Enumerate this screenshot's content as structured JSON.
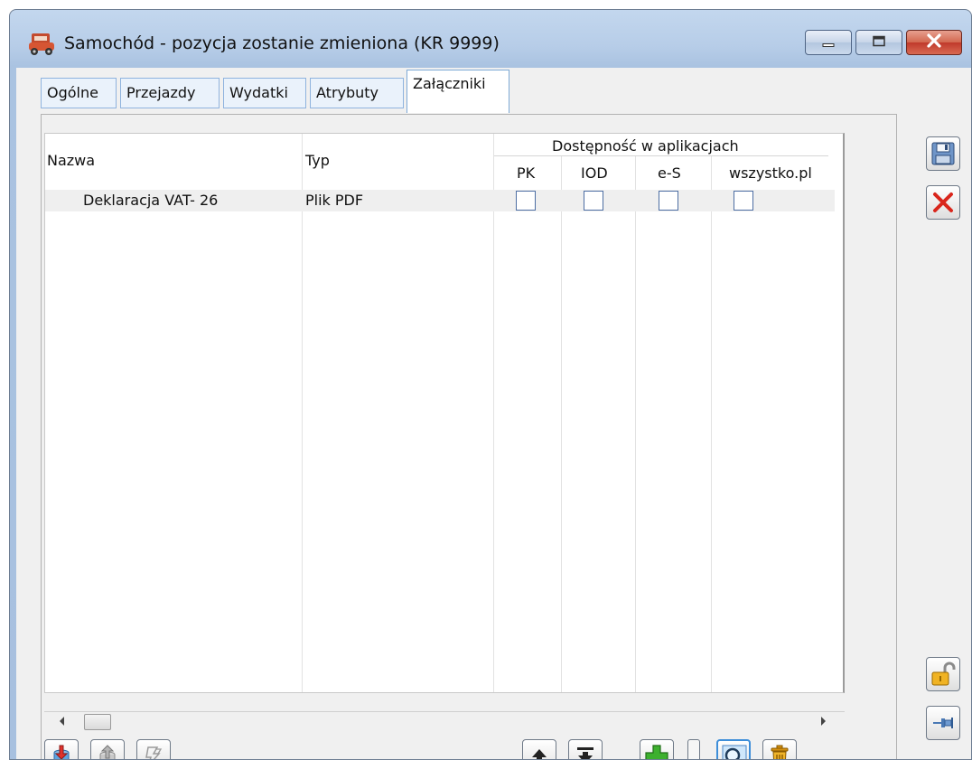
{
  "window": {
    "title": "Samochód - pozycja zostanie zmieniona  (KR 9999)",
    "icon": "car-icon",
    "caption_buttons": [
      "minimize-icon",
      "restore-icon",
      "close-icon"
    ]
  },
  "tabs": [
    {
      "label": "Ogólne",
      "active": false
    },
    {
      "label": "Przejazdy",
      "active": false
    },
    {
      "label": "Wydatki",
      "active": false
    },
    {
      "label": "Atrybuty",
      "active": false
    },
    {
      "label": "Załączniki",
      "active": true
    }
  ],
  "grid": {
    "columns": {
      "nazwa": "Nazwa",
      "typ": "Typ",
      "group": "Dostępność w aplikacjach",
      "pk": "PK",
      "iod": "IOD",
      "es": "e-S",
      "wszystko": "wszystko.pl"
    },
    "rows": [
      {
        "nazwa": "Deklaracja VAT- 26",
        "typ": "Plik PDF",
        "pk": false,
        "iod": false,
        "es": false,
        "wszystko": false
      }
    ]
  },
  "bottom_toolbar": [
    "import-icon",
    "export-icon",
    "flash-icon",
    "move-up-icon",
    "move-down-icon",
    "add-icon",
    "dropdown-icon",
    "preview-icon",
    "delete-icon"
  ],
  "side_toolbar": [
    "save-icon",
    "cancel-icon",
    "lock-icon",
    "pin-icon"
  ]
}
